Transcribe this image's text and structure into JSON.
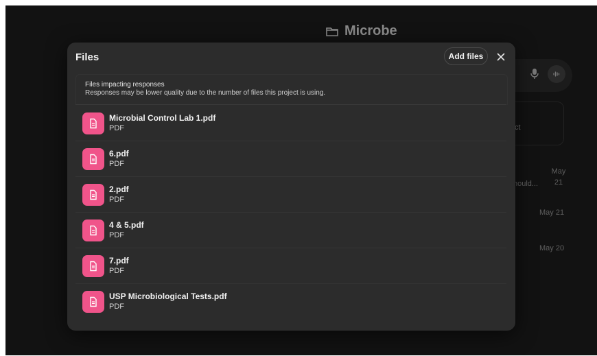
{
  "background": {
    "project_title": "Microbe",
    "card_text": "ct",
    "rows": [
      {
        "snippet": "hould...",
        "date": "May 21"
      },
      {
        "snippet": "",
        "date": "May 21"
      },
      {
        "snippet": "",
        "date": "May 20"
      }
    ]
  },
  "modal": {
    "title": "Files",
    "add_files_label": "Add files",
    "notice": {
      "title": "Files impacting responses",
      "body": "Responses may be lower quality due to the number of files this project is using."
    },
    "files": [
      {
        "name": "Microbial Control Lab 1.pdf",
        "type": "PDF"
      },
      {
        "name": "6.pdf",
        "type": "PDF"
      },
      {
        "name": "2.pdf",
        "type": "PDF"
      },
      {
        "name": "4 & 5.pdf",
        "type": "PDF"
      },
      {
        "name": "7.pdf",
        "type": "PDF"
      },
      {
        "name": "USP Microbiological Tests.pdf",
        "type": "PDF"
      }
    ]
  },
  "colors": {
    "file_icon": "#f0548a",
    "modal_bg": "#2c2c2c",
    "backdrop": "#121212"
  },
  "icons": {
    "title": "folder-icon",
    "file": "document-icon",
    "close": "close-icon",
    "mic": "microphone-icon",
    "voice": "voice-waveform-icon"
  }
}
